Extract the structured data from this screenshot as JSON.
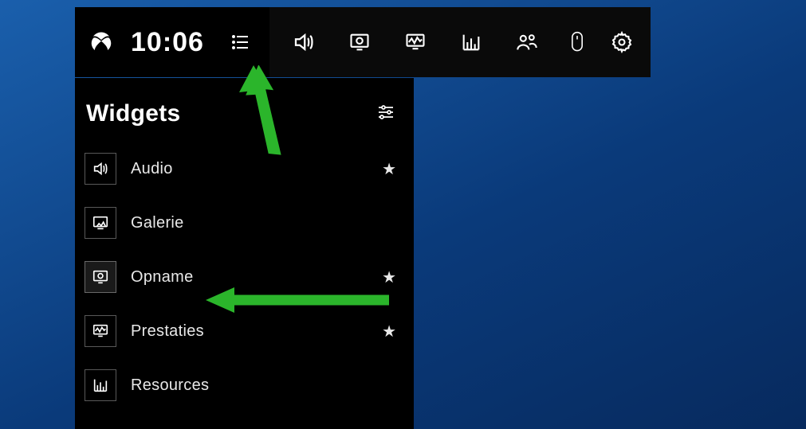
{
  "topbar": {
    "clock": "10:06",
    "buttons": [
      {
        "name": "xbox-icon"
      },
      {
        "name": "clock-text"
      },
      {
        "name": "widgets-icon"
      },
      {
        "name": "audio-icon"
      },
      {
        "name": "capture-icon"
      },
      {
        "name": "performance-icon"
      },
      {
        "name": "resources-icon"
      },
      {
        "name": "looking-for-group-icon"
      },
      {
        "name": "mouse-icon"
      },
      {
        "name": "settings-icon"
      }
    ]
  },
  "panel": {
    "title": "Widgets",
    "settings_icon": "sliders-icon",
    "items": [
      {
        "icon": "audio-icon",
        "label": "Audio",
        "starred": true,
        "selected": false
      },
      {
        "icon": "gallery-icon",
        "label": "Galerie",
        "starred": false,
        "selected": false
      },
      {
        "icon": "capture-icon",
        "label": "Opname",
        "starred": true,
        "selected": true
      },
      {
        "icon": "performance-icon",
        "label": "Prestaties",
        "starred": true,
        "selected": false
      },
      {
        "icon": "resources-icon",
        "label": "Resources",
        "starred": false,
        "selected": false
      }
    ]
  },
  "annotations": {
    "arrow_color": "#2bb52b"
  }
}
